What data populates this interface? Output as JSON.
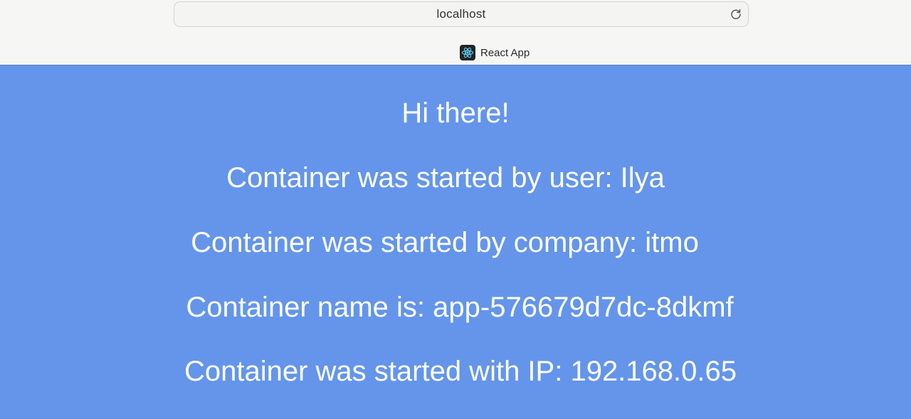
{
  "browser": {
    "url": "localhost",
    "tab_title": "React App",
    "favicon": "react-logo-icon",
    "reload": "reload-icon"
  },
  "page": {
    "background": "#6495ea",
    "text_color": "#ffffff",
    "greeting": "Hi there!",
    "user_line": "Container was started by user: Ilya",
    "company_line": "Container was started by company: itmo",
    "name_line": "Container name is: app-576679d7dc-8dkmf",
    "ip_line": "Container was started with IP: 192.168.0.65"
  }
}
